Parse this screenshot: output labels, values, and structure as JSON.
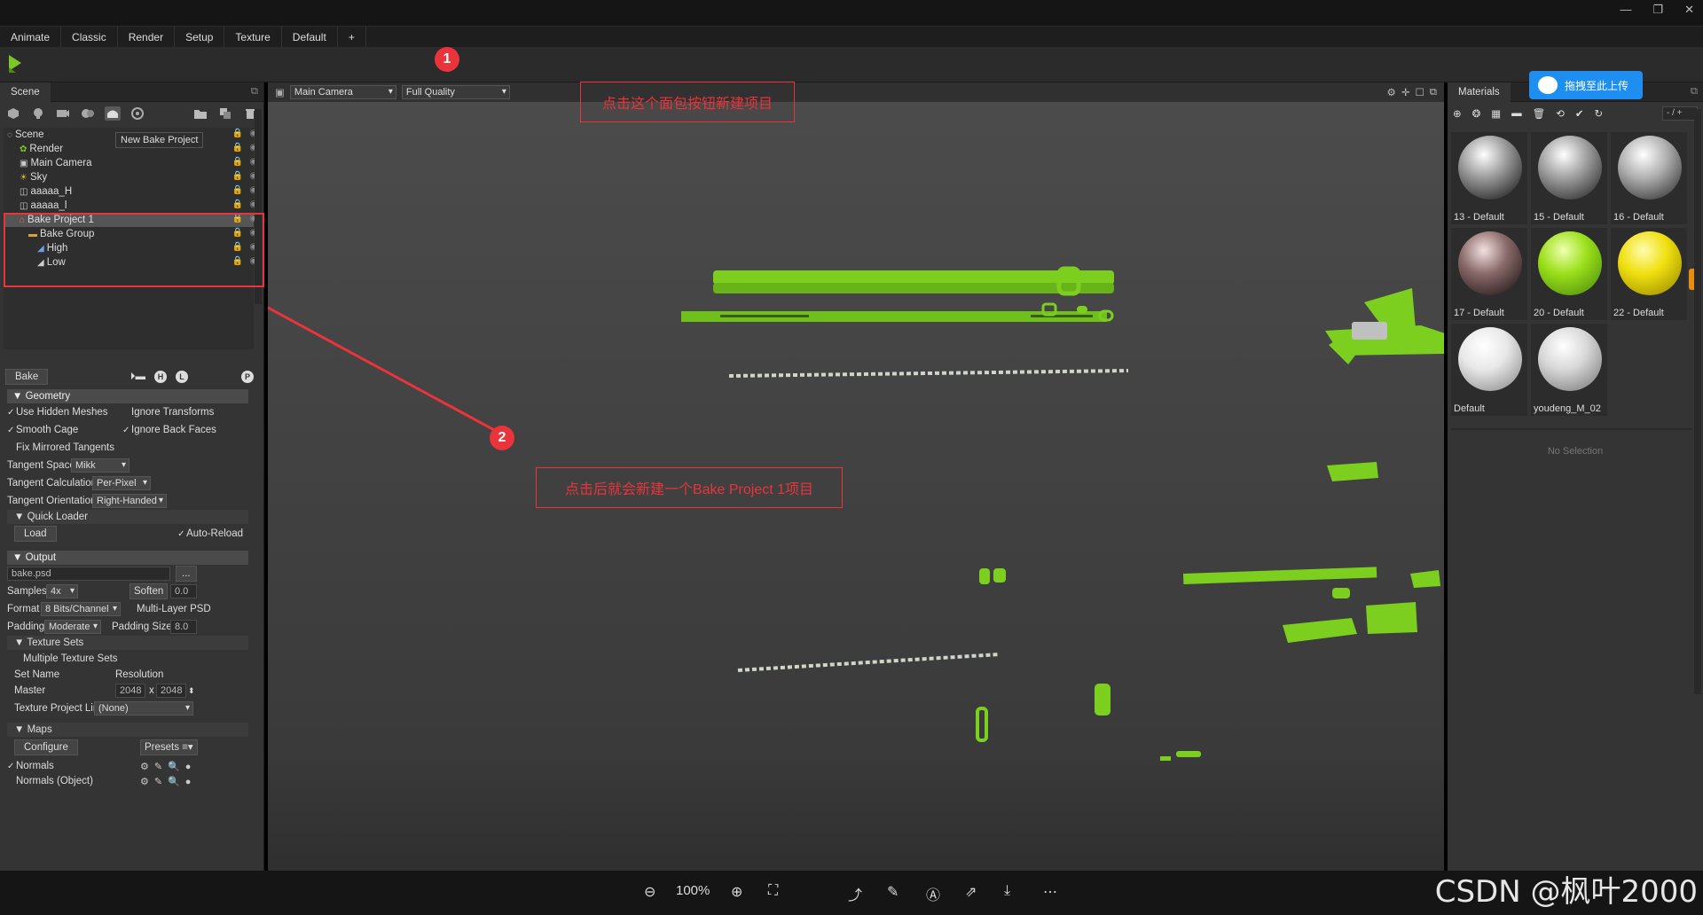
{
  "menu": [
    "Animate",
    "Classic",
    "Render",
    "Setup",
    "Texture",
    "Default",
    "+"
  ],
  "left": {
    "tab": "Scene",
    "tooltip": "New Bake Project",
    "tree": [
      {
        "label": "Scene"
      },
      {
        "label": "Render"
      },
      {
        "label": "Main Camera"
      },
      {
        "label": "Sky"
      },
      {
        "label": "aaaaa_H"
      },
      {
        "label": "aaaaa_l"
      },
      {
        "label": "Bake Project 1"
      },
      {
        "label": "Bake Group"
      },
      {
        "label": "High"
      },
      {
        "label": "Low"
      }
    ],
    "bake_btn": "Bake",
    "geometry": "Geometry",
    "use_hidden": "Use Hidden Meshes",
    "ignore_transforms": "Ignore Transforms",
    "smooth_cage": "Smooth Cage",
    "ignore_back": "Ignore Back Faces",
    "fix_mirrored": "Fix Mirrored Tangents",
    "tangent_space": "Tangent Space",
    "tangent_space_val": "Mikk",
    "tangent_calc": "Tangent Calculation",
    "tangent_calc_val": "Per-Pixel",
    "tangent_orient": "Tangent Orientation",
    "tangent_orient_val": "Right-Handed",
    "quick_loader": "Quick Loader",
    "load": "Load",
    "auto_reload": "Auto-Reload",
    "output": "Output",
    "file": "bake.psd",
    "browse": "...",
    "samples": "Samples",
    "samples_val": "4x",
    "soften": "Soften",
    "soften_val": "0.0",
    "format": "Format",
    "format_val": "8 Bits/Channel",
    "multilayer": "Multi-Layer PSD",
    "padding": "Padding",
    "padding_val": "Moderate",
    "padding_size": "Padding Size:",
    "padding_size_val": "8.0",
    "texture_sets": "Texture Sets",
    "multiple_sets": "Multiple Texture Sets",
    "set_name": "Set Name",
    "resolution": "Resolution",
    "master": "Master",
    "res_w": "2048",
    "res_x": "x",
    "res_h": "2048",
    "tex_link": "Texture Project Link",
    "tex_link_val": "(None)",
    "maps": "Maps",
    "configure": "Configure",
    "presets": "Presets",
    "normals": "Normals",
    "normals_obj": "Normals (Object)"
  },
  "viewport": {
    "camera": "Main Camera",
    "quality": "Full Quality"
  },
  "right": {
    "tab": "Materials",
    "counter": "- / +",
    "materials": [
      "13 - Default",
      "15 - Default",
      "16 - Default",
      "17 - Default",
      "20 - Default",
      "22 - Default",
      "Default",
      "youdeng_M_02"
    ],
    "no_selection": "No Selection",
    "upload": "拖拽至此上传"
  },
  "annotations": {
    "n1": "1",
    "n2": "2",
    "a1": "点击这个面包按钮新建项目",
    "a2": "点击后就会新建一个Bake Project 1项目"
  },
  "bottom": {
    "zoom": "100%"
  },
  "watermark": "CSDN @枫叶2000"
}
